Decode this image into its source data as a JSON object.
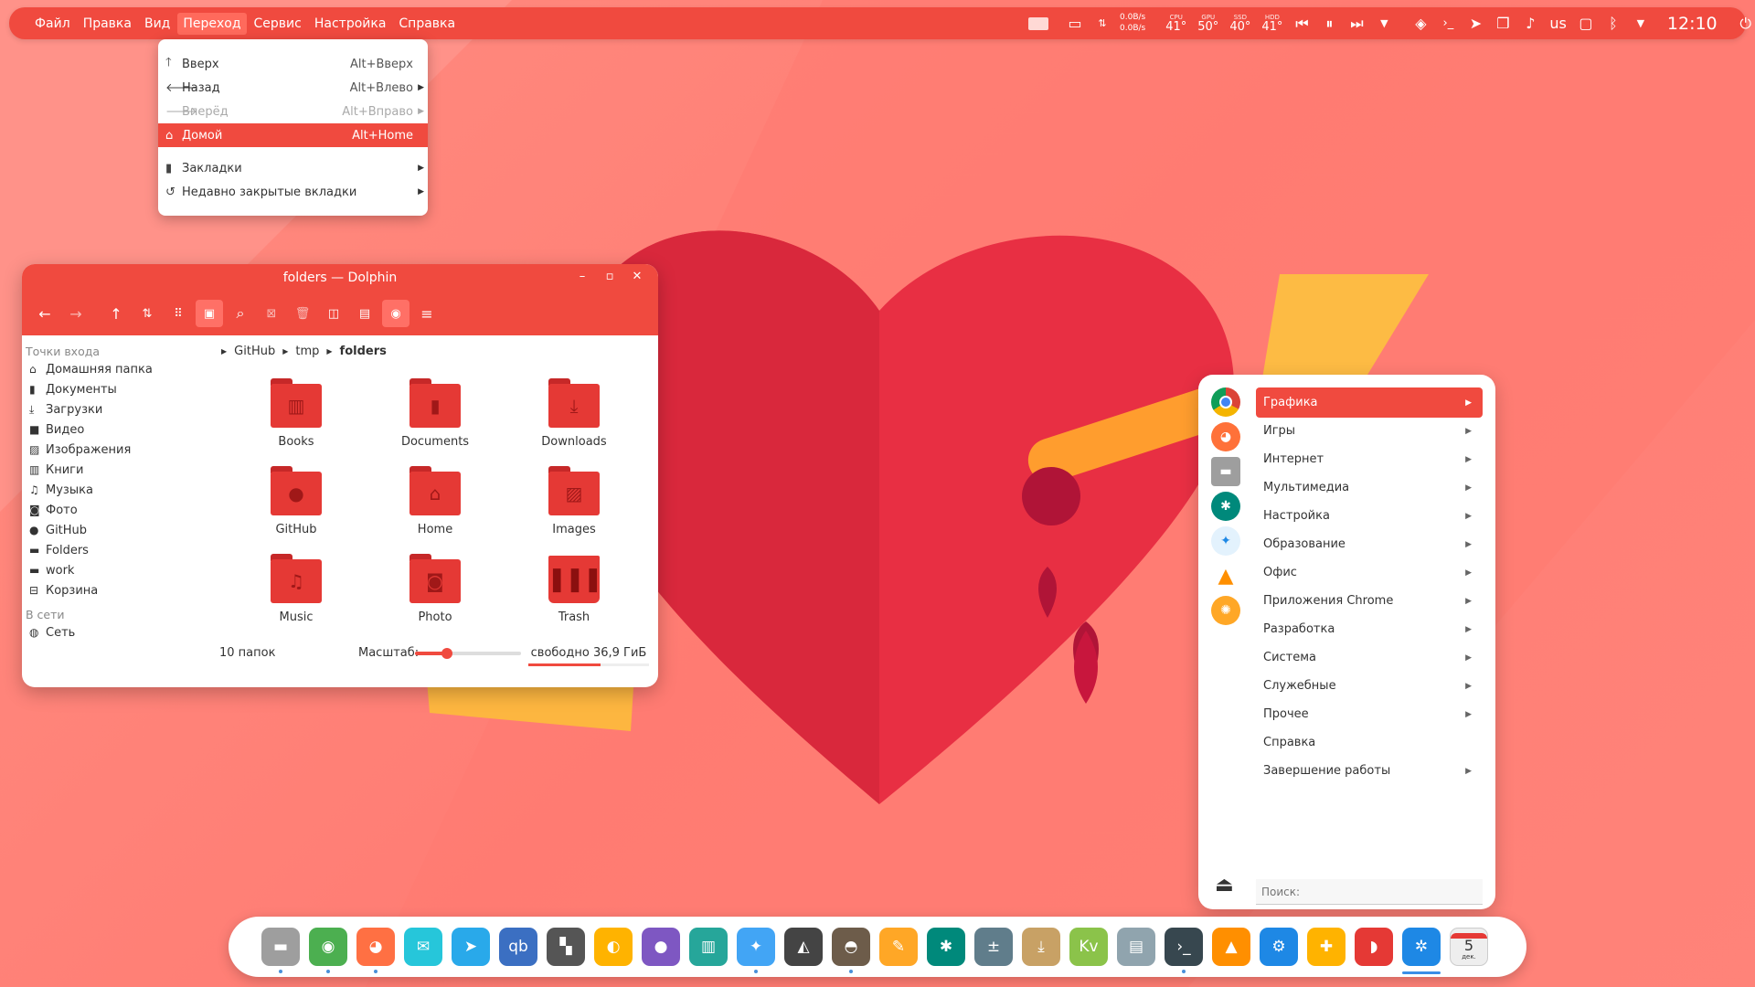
{
  "topbar": {
    "menus": [
      "Файл",
      "Правка",
      "Вид",
      "Переход",
      "Сервис",
      "Настройка",
      "Справка"
    ],
    "active_menu": "Переход",
    "net_down": "0.0B/s",
    "net_up": "0.0B/s",
    "temps": [
      {
        "label": "CPU",
        "value": "41°"
      },
      {
        "label": "GPU",
        "value": "50°"
      },
      {
        "label": "SSD",
        "value": "40°"
      },
      {
        "label": "HDD",
        "value": "41°"
      }
    ],
    "keyboard_layout": "us",
    "clock": "12:10"
  },
  "dropdown": {
    "items": [
      {
        "icon": "arrow-up-icon",
        "label": "Вверх",
        "shortcut": "Alt+Вверх",
        "arrow": false,
        "state": "normal"
      },
      {
        "icon": "arrow-left-icon",
        "label": "Назад",
        "shortcut": "Alt+Влево",
        "arrow": true,
        "state": "normal"
      },
      {
        "icon": "arrow-right-icon",
        "label": "Вперёд",
        "shortcut": "Alt+Вправо",
        "arrow": true,
        "state": "disabled"
      },
      {
        "icon": "home-icon",
        "label": "Домой",
        "shortcut": "Alt+Home",
        "arrow": false,
        "state": "selected"
      },
      {
        "icon": "bookmark-icon",
        "label": "Закладки",
        "shortcut": "",
        "arrow": true,
        "state": "normal"
      },
      {
        "icon": "undo-icon",
        "label": "Недавно закрытые вкладки",
        "shortcut": "",
        "arrow": true,
        "state": "normal"
      }
    ]
  },
  "dolphin": {
    "title": "folders — Dolphin",
    "places_header": "Точки входа",
    "places": [
      "Домашняя папка",
      "Документы",
      "Загрузки",
      "Видео",
      "Изображения",
      "Книги",
      "Музыка",
      "Фото",
      "GitHub",
      "Folders",
      "work",
      "Корзина"
    ],
    "network_header": "В сети",
    "network": [
      "Сеть"
    ],
    "breadcrumb": [
      "GitHub",
      "tmp",
      "folders"
    ],
    "files": [
      {
        "name": "Books",
        "icon": "book"
      },
      {
        "name": "Documents",
        "icon": "document"
      },
      {
        "name": "Downloads",
        "icon": "download"
      },
      {
        "name": "GitHub",
        "icon": "github"
      },
      {
        "name": "Home",
        "icon": "home"
      },
      {
        "name": "Images",
        "icon": "image"
      },
      {
        "name": "Music",
        "icon": "music"
      },
      {
        "name": "Photo",
        "icon": "camera"
      },
      {
        "name": "Trash",
        "icon": "trash"
      }
    ],
    "status": "10 папок",
    "zoom_label": "Масштаб:",
    "zoom_level": 0.3,
    "free_space": "свободно 36,9 ГиБ",
    "free_fraction": 0.6
  },
  "appmenu": {
    "favorites": [
      "chrome",
      "firefox",
      "files",
      "settings",
      "kdeconnect",
      "vlc",
      "citrus"
    ],
    "categories": [
      {
        "label": "Графика",
        "arrow": true,
        "selected": true
      },
      {
        "label": "Игры",
        "arrow": true
      },
      {
        "label": "Интернет",
        "arrow": true
      },
      {
        "label": "Мультимедиа",
        "arrow": true
      },
      {
        "label": "Настройка",
        "arrow": true
      },
      {
        "label": "Образование",
        "arrow": true
      },
      {
        "label": "Офис",
        "arrow": true
      },
      {
        "label": "Приложения Chrome",
        "arrow": true
      },
      {
        "label": "Разработка",
        "arrow": true
      },
      {
        "label": "Система",
        "arrow": true
      },
      {
        "label": "Служебные",
        "arrow": true
      },
      {
        "label": "Прочее",
        "arrow": true
      },
      {
        "label": "Справка",
        "arrow": false
      },
      {
        "label": "Завершение работы",
        "arrow": true
      }
    ],
    "search_placeholder": "Поиск:"
  },
  "dock": {
    "apps": [
      {
        "name": "files",
        "color": "#9e9e9e",
        "running": true
      },
      {
        "name": "chrome",
        "color": "#4caf50",
        "running": true
      },
      {
        "name": "firefox",
        "color": "#ff7043",
        "running": true
      },
      {
        "name": "mail",
        "color": "#26c6da",
        "running": false
      },
      {
        "name": "telegram",
        "color": "#29a9ea",
        "running": false
      },
      {
        "name": "qbittorrent",
        "color": "#3b6fc2",
        "running": false
      },
      {
        "name": "inkscape-like",
        "color": "#555555",
        "running": false
      },
      {
        "name": "color-app",
        "color": "#ffb300",
        "running": false
      },
      {
        "name": "github",
        "color": "#7e57c2",
        "running": false
      },
      {
        "name": "reader",
        "color": "#26a69a",
        "running": false
      },
      {
        "name": "kdeconnect",
        "color": "#42a5f5",
        "running": true
      },
      {
        "name": "inkscape",
        "color": "#444444",
        "running": false
      },
      {
        "name": "gimp",
        "color": "#6d5c4a",
        "running": true
      },
      {
        "name": "color-picker",
        "color": "#ffa726",
        "running": false
      },
      {
        "name": "settings",
        "color": "#00897b",
        "running": false
      },
      {
        "name": "calculator",
        "color": "#607d8b",
        "running": false
      },
      {
        "name": "ark",
        "color": "#c8a165",
        "running": false
      },
      {
        "name": "kvantum",
        "color": "#8bc34a",
        "running": false
      },
      {
        "name": "system-monitor",
        "color": "#90a4ae",
        "running": false
      },
      {
        "name": "terminal",
        "color": "#37474f",
        "running": true
      },
      {
        "name": "vlc",
        "color": "#ff8f00",
        "running": false
      },
      {
        "name": "kdevelop",
        "color": "#1e88e5",
        "running": false
      },
      {
        "name": "games",
        "color": "#ffb300",
        "running": false
      },
      {
        "name": "mailspring",
        "color": "#e53935",
        "running": false
      },
      {
        "name": "kde",
        "color": "#1e88e5",
        "running": true
      },
      {
        "name": "calendar",
        "color": "#eeeeee",
        "running": false
      }
    ],
    "calendar_day": "5",
    "calendar_month": "дек."
  }
}
